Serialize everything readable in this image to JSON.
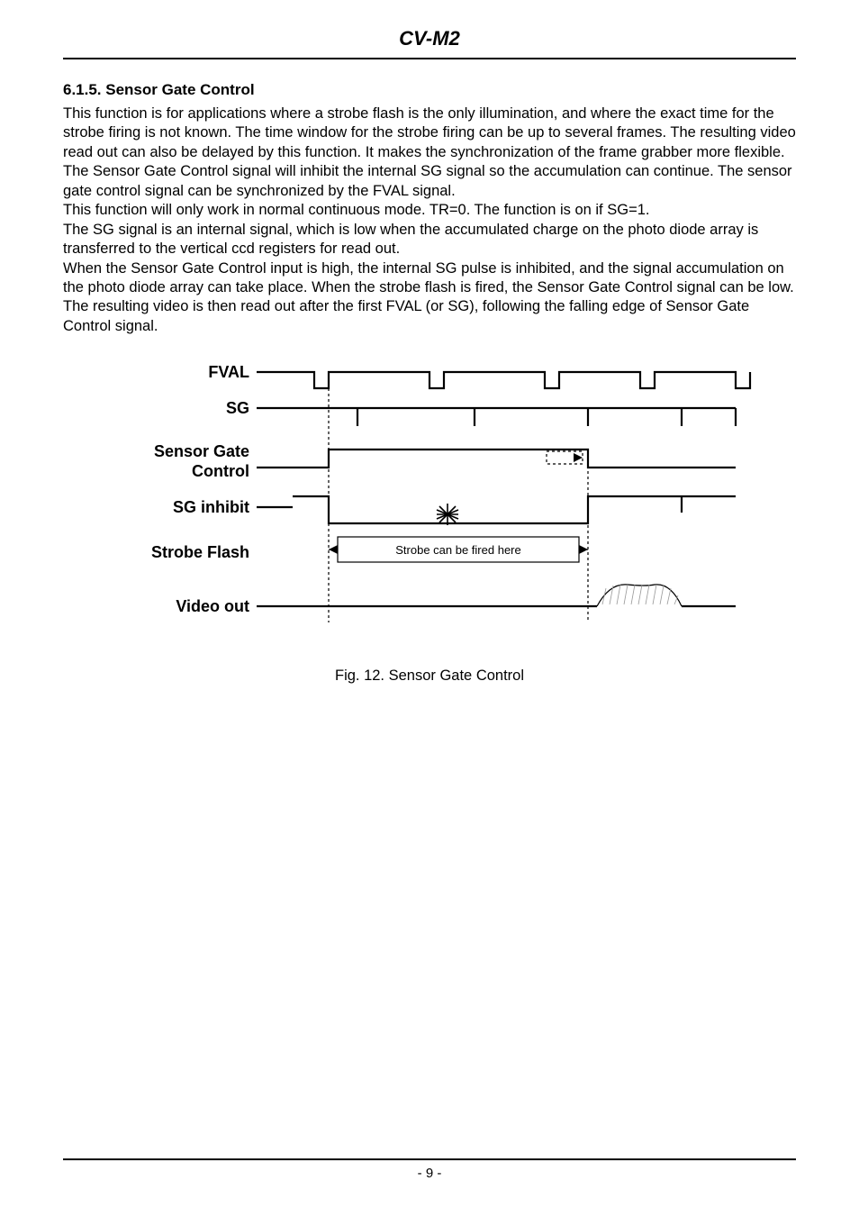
{
  "header": {
    "title": "CV-M2"
  },
  "section": {
    "number_title": "6.1.5. Sensor Gate Control",
    "paragraph": "This function is for applications where a strobe flash is the only illumination, and where the exact time for the strobe firing is not known. The time window for the strobe firing can be up to several frames. The resulting video read out can also be delayed by this function. It makes the synchronization of the frame grabber more flexible.\nThe Sensor Gate Control signal will inhibit the internal SG signal so the accumulation can continue. The sensor gate control signal can be synchronized by the FVAL signal.\nThis function will only work in normal continuous mode. TR=0. The function is on if SG=1.\nThe SG signal is an internal signal, which is low when the accumulated charge on the photo diode array is transferred to the vertical ccd registers for read out.\nWhen the Sensor Gate Control input is high, the internal SG pulse is inhibited, and the signal accumulation on the photo diode array can take place. When the strobe flash is fired, the Sensor Gate Control signal can be low. The resulting video is then read out after the first FVAL (or SG), following the falling edge of Sensor Gate Control signal."
  },
  "figure": {
    "labels": {
      "fval": "FVAL",
      "sg": "SG",
      "sensor_gate": "Sensor Gate",
      "control": "Control",
      "sg_inhibit": "SG inhibit",
      "strobe_flash": "Strobe Flash",
      "video_out": "Video out",
      "strobe_note": "Strobe can be fired here"
    },
    "caption": "Fig. 12. Sensor Gate Control"
  },
  "footer": {
    "page": "- 9 -"
  }
}
